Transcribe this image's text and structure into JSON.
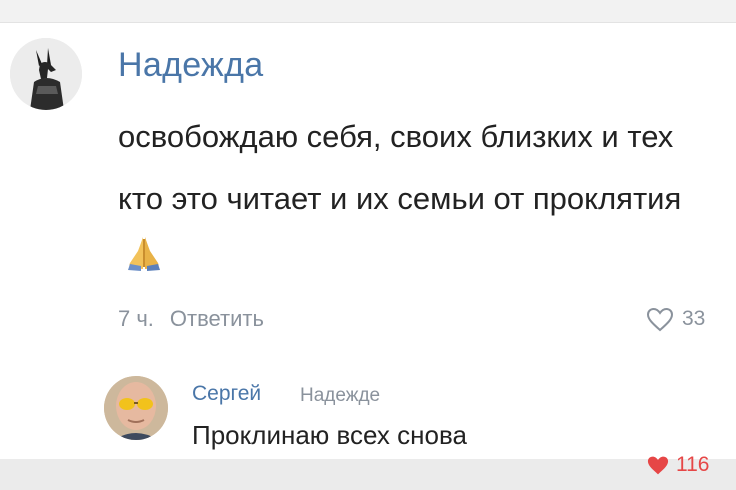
{
  "comments": [
    {
      "author": "Надежда",
      "text": "освобождаю себя, своих близких и тех кто это читает и их семьи от проклятия",
      "emoji_icon": "praying-hands-icon",
      "time": "7 ч.",
      "reply_label": "Ответить",
      "likes": "33",
      "liked": false,
      "avatar_icon": "anubis-statue-avatar"
    },
    {
      "author": "Сергей",
      "reply_to": "Надежде",
      "text": "Проклинаю всех снова",
      "likes": "116",
      "liked": true,
      "avatar_icon": "man-with-sunglasses-avatar"
    }
  ],
  "colors": {
    "author_link": "#4a76a8",
    "meta_gray": "#8a929c",
    "like_active": "#e64646",
    "text": "#222222"
  }
}
